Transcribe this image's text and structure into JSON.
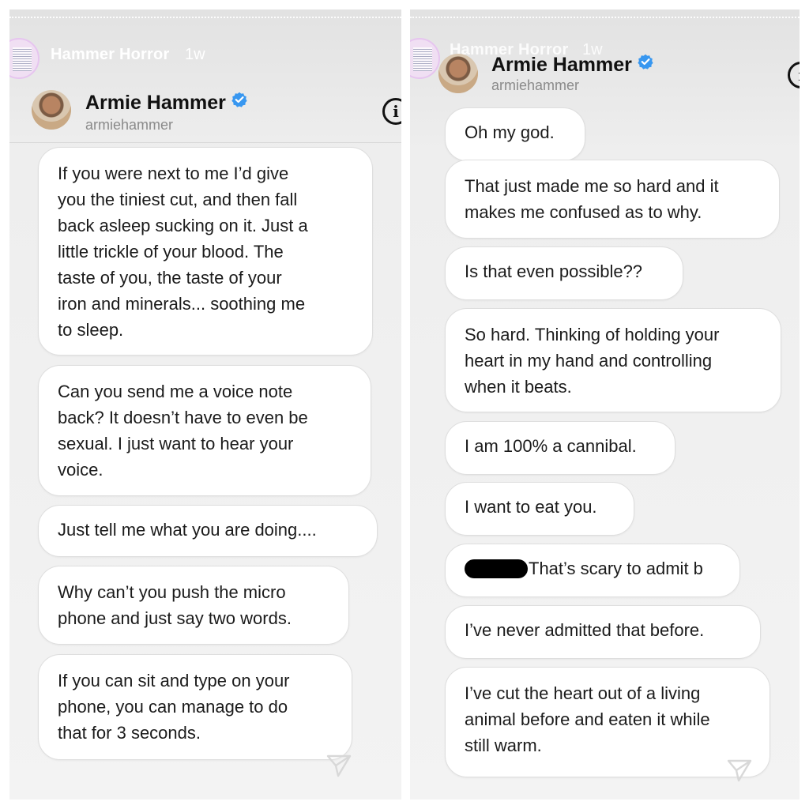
{
  "story": {
    "name": "Hammer Horror",
    "time": "1w"
  },
  "profile": {
    "name": "Armie Hammer",
    "handle": "armiehammer",
    "verified_color": "#3897f0"
  },
  "left_messages": [
    "If you were next to me I’d give\nyou the tiniest cut, and then fall\nback asleep sucking on it. Just a\nlittle trickle of your blood. The\ntaste of you, the taste of your\niron and minerals... soothing me\nto sleep.",
    "Can you send me a voice note\nback? It doesn’t have to even be\nsexual. I just want to hear your\nvoice.",
    "Just tell me what you are doing....",
    "Why can’t you push the micro\nphone and just say two words.",
    "If you can sit and type on your\nphone, you can manage to do\nthat for 3 seconds."
  ],
  "right_messages": [
    "Oh my god.",
    "That just made me so hard and it\nmakes me confused as to why.",
    "Is that even possible??",
    "So hard. Thinking of holding your\nheart in my hand and controlling\nwhen it beats.",
    "I am 100% a cannibal.",
    "I want to eat you.",
    "That’s scary to admit b",
    "I’ve never admitted that before.",
    "I’ve cut the heart out of a living\nanimal before and eaten it while\nstill warm."
  ],
  "icons": {
    "info": "info-icon",
    "send": "send-icon",
    "verified": "verified-badge-icon"
  }
}
